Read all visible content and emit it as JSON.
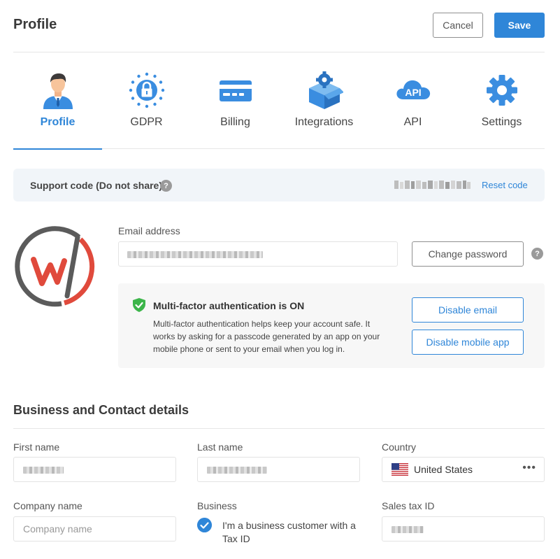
{
  "header": {
    "title": "Profile",
    "cancel_label": "Cancel",
    "save_label": "Save"
  },
  "tabs": [
    {
      "label": "Profile",
      "icon": "user-avatar-icon",
      "active": true
    },
    {
      "label": "GDPR",
      "icon": "gdpr-lock-icon",
      "active": false
    },
    {
      "label": "Billing",
      "icon": "credit-card-icon",
      "active": false
    },
    {
      "label": "Integrations",
      "icon": "integrations-box-icon",
      "active": false
    },
    {
      "label": "API",
      "icon": "api-cloud-icon",
      "active": false
    },
    {
      "label": "Settings",
      "icon": "gear-icon",
      "active": false
    }
  ],
  "support": {
    "label": "Support code (Do not share)",
    "help": "?",
    "reset_label": "Reset code"
  },
  "account": {
    "email_label": "Email address",
    "change_password_label": "Change password",
    "help": "?"
  },
  "mfa": {
    "title": "Multi-factor authentication is ON",
    "description": "Multi-factor authentication helps keep your account safe. It works by asking for a passcode generated by an app on your mobile phone or sent to your email when you log in.",
    "disable_email_label": "Disable email",
    "disable_app_label": "Disable mobile app"
  },
  "business": {
    "section_title": "Business and Contact details",
    "first_name_label": "First name",
    "last_name_label": "Last name",
    "country_label": "Country",
    "country_value": "United States",
    "country_more": "•••",
    "company_label": "Company name",
    "company_placeholder": "Company name",
    "business_label": "Business",
    "business_checkbox_label": "I'm a business customer with a Tax ID",
    "business_checked": true,
    "sales_tax_label": "Sales tax ID"
  },
  "colors": {
    "accent": "#2f86d8",
    "logo_red": "#e04a3c",
    "logo_gray": "#5b5b5b",
    "mfa_green": "#3cb54a"
  }
}
